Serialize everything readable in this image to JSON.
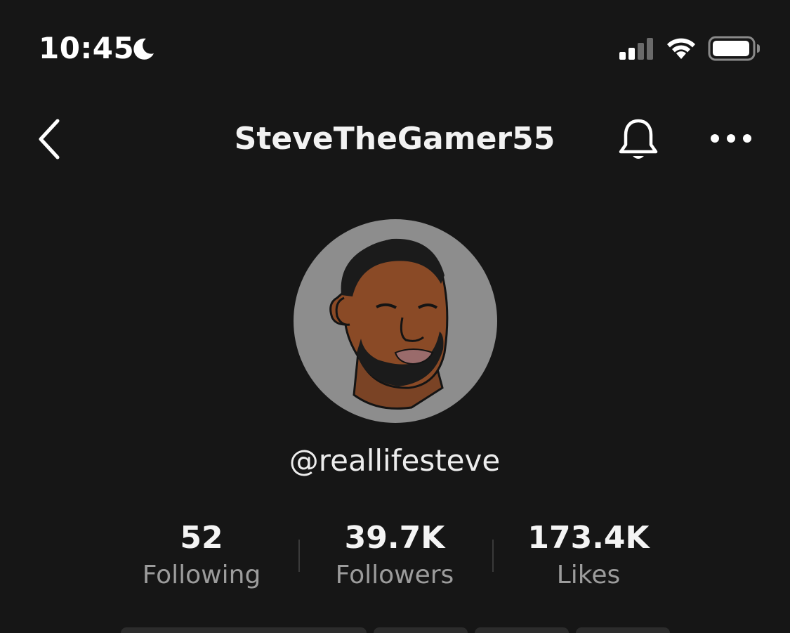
{
  "status_bar": {
    "time": "10:45",
    "focus_icon": "moon-icon",
    "signal_icon": "cellular-signal-icon",
    "wifi_icon": "wifi-icon",
    "battery_icon": "battery-icon"
  },
  "nav": {
    "back_icon": "chevron-left-icon",
    "title": "SteveTheGamer55",
    "bell_icon": "bell-icon",
    "more_icon": "more-horizontal-icon"
  },
  "profile": {
    "avatar_icon": "avatar",
    "handle": "@reallifesteve"
  },
  "stats": [
    {
      "value": "52",
      "label": "Following"
    },
    {
      "value": "39.7K",
      "label": "Followers"
    },
    {
      "value": "173.4K",
      "label": "Likes"
    }
  ],
  "colors": {
    "background": "#161616",
    "text_primary": "#ffffff",
    "text_secondary": "#9c9c9c",
    "avatar_bg": "#8d8d8d"
  }
}
